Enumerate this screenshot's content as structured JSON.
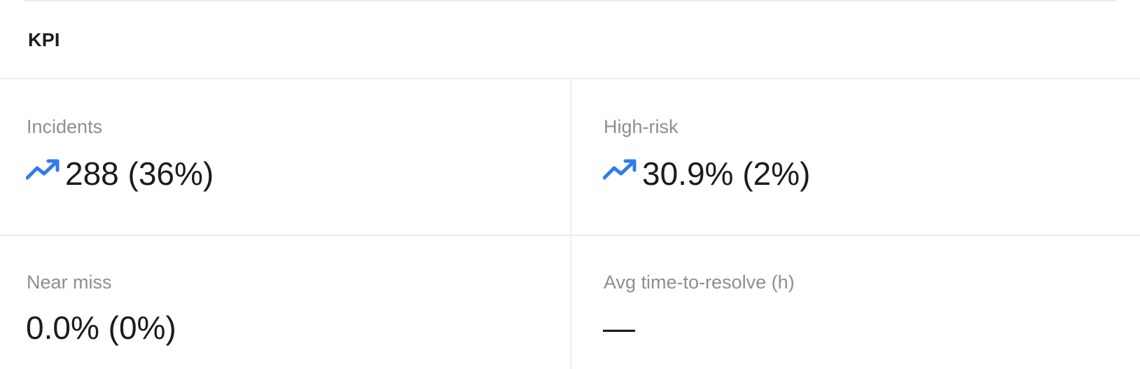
{
  "header": {
    "title": "KPI"
  },
  "kpis": [
    {
      "label": "Incidents",
      "value": "288 (36%)",
      "trend_icon": "trending-up-icon"
    },
    {
      "label": "High-risk",
      "value": "30.9% (2%)",
      "trend_icon": "trending-up-icon"
    },
    {
      "label": "Near miss",
      "value": "0.0% (0%)"
    },
    {
      "label": "Avg time-to-resolve (h)",
      "value": "—"
    }
  ],
  "colors": {
    "trend_up": "#2f7bf0",
    "label": "#8e8e93",
    "value": "#1c1c1e",
    "divider": "#ececec"
  }
}
